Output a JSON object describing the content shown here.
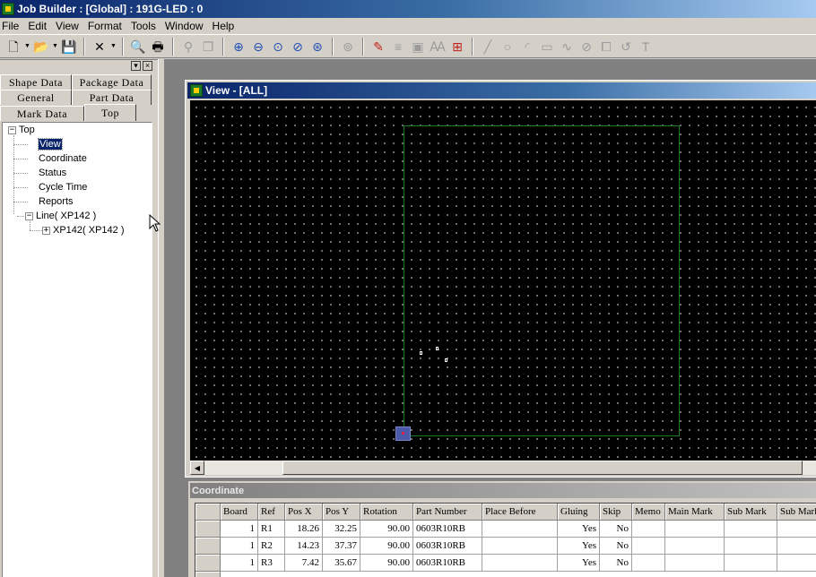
{
  "app": {
    "title": "Job Builder : [Global] : 191G-LED : 0"
  },
  "menu": [
    "File",
    "Edit",
    "View",
    "Format",
    "Tools",
    "Window",
    "Help"
  ],
  "toolbar": {
    "icons": [
      "new-file-icon",
      "open-folder-icon",
      "save-icon",
      "delete-icon",
      "print-preview-icon",
      "print-icon",
      "find-icon",
      "copy-icon",
      "zoom-in-icon",
      "zoom-out-icon",
      "zoom-fit-icon",
      "zoom-window-icon",
      "zoom-all-icon",
      "zoom-previous-icon",
      "paint-icon",
      "line-style-icon",
      "image-icon",
      "text-style-icon",
      "grid-icon",
      "line-tool-icon",
      "circle-tool-icon",
      "arc-tool-icon",
      "rectangle-tool-icon",
      "curve-tool-icon",
      "polygon-tool-icon",
      "frame-tool-icon",
      "rotate-tool-icon",
      "text-tool-icon"
    ]
  },
  "left_panel": {
    "tabs_row1": [
      "Shape Data",
      "Package Data"
    ],
    "tabs_row2": [
      "General",
      "Part Data"
    ],
    "tabs_row3": [
      "Mark Data",
      "Top"
    ],
    "active_tab": "Top",
    "tree": {
      "root": "Top",
      "children": [
        "View",
        "Coordinate",
        "Status",
        "Cycle Time",
        "Reports"
      ],
      "selected": "View",
      "line": "Line( XP142 )",
      "machine": "XP142( XP142 )"
    }
  },
  "view_window": {
    "title": "View - [ALL]"
  },
  "coordinate": {
    "title": "Coordinate",
    "columns": [
      "Board",
      "Ref",
      "Pos X",
      "Pos Y",
      "Rotation",
      "Part Number",
      "Place Before",
      "Gluing",
      "Skip",
      "Memo",
      "Main Mark",
      "Sub Mark",
      "Sub Mark"
    ],
    "rows": [
      {
        "board": "1",
        "ref": "R1",
        "pos_x": "18.26",
        "pos_y": "32.25",
        "rotation": "90.00",
        "part_number": "0603R10RB",
        "place_before": "",
        "gluing": "Yes",
        "skip": "No",
        "memo": "",
        "main_mark": "",
        "sub_mark": "",
        "sub_mark2": ""
      },
      {
        "board": "1",
        "ref": "R2",
        "pos_x": "14.23",
        "pos_y": "37.37",
        "rotation": "90.00",
        "part_number": "0603R10RB",
        "place_before": "",
        "gluing": "Yes",
        "skip": "No",
        "memo": "",
        "main_mark": "",
        "sub_mark": "",
        "sub_mark2": ""
      },
      {
        "board": "1",
        "ref": "R3",
        "pos_x": "7.42",
        "pos_y": "35.67",
        "rotation": "90.00",
        "part_number": "0603R10RB",
        "place_before": "",
        "gluing": "Yes",
        "skip": "No",
        "memo": "",
        "main_mark": "",
        "sub_mark": "",
        "sub_mark2": ""
      }
    ]
  }
}
